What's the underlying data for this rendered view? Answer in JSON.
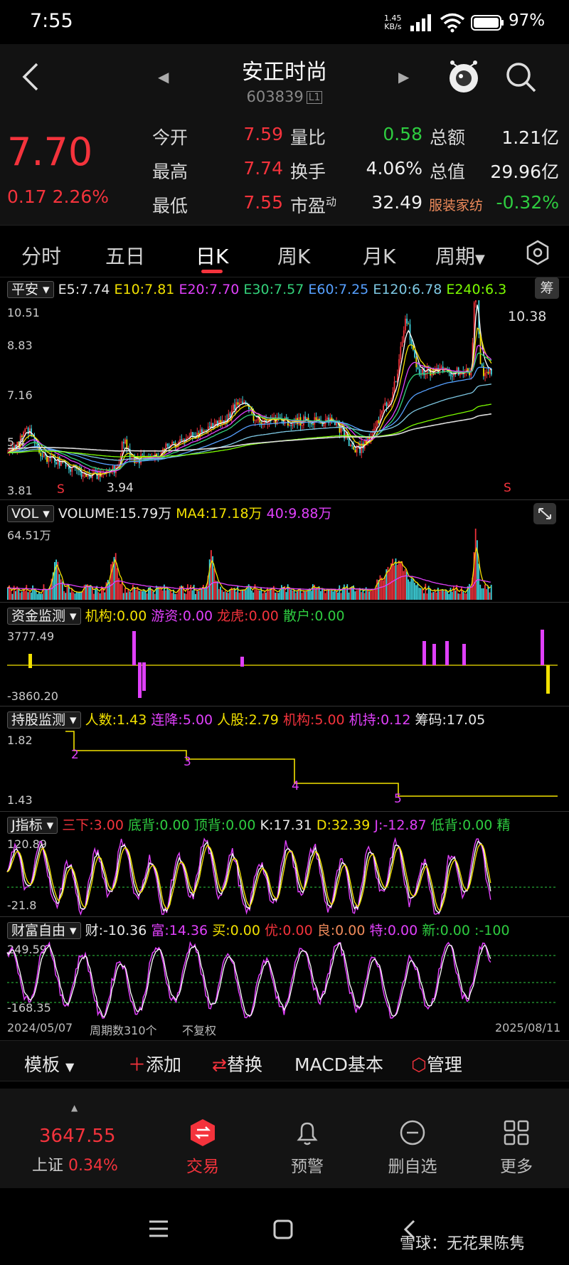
{
  "status_bar": {
    "time": "7:55",
    "net_speed": "1.45",
    "net_unit": "KB/s",
    "battery": "97%"
  },
  "header": {
    "name": "安正时尚",
    "code": "603839",
    "level": "L1"
  },
  "quote": {
    "price": "7.70",
    "change": "0.17 2.26%",
    "rows": [
      {
        "l1": "今开",
        "v1": "7.59",
        "l2": "量比",
        "v2": "0.58",
        "l3": "总额",
        "v3": "1.21亿"
      },
      {
        "l1": "最高",
        "v1": "7.74",
        "l2": "换手",
        "v2": "4.06%",
        "l3": "总值",
        "v3": "29.96亿"
      },
      {
        "l1": "最低",
        "v1": "7.55",
        "l2": "市盈",
        "l2_sup": "动",
        "v2": "32.49",
        "l3": "服装家纺",
        "v3": "-0.32%"
      }
    ]
  },
  "tabs": [
    "分时",
    "五日",
    "日K",
    "周K",
    "月K",
    "周期"
  ],
  "active_tab": "日K",
  "kline": {
    "select": "平安",
    "ma": [
      {
        "label": "E5:",
        "value": "7.74",
        "color": "#ffffff"
      },
      {
        "label": "E10:",
        "value": "7.81",
        "color": "#f2e100"
      },
      {
        "label": "E20:",
        "value": "7.70",
        "color": "#e040fb"
      },
      {
        "label": "E30:",
        "value": "7.57",
        "color": "#33d17a"
      },
      {
        "label": "E60:",
        "value": "7.25",
        "color": "#56a0ff"
      },
      {
        "label": "E120:",
        "value": "6.78",
        "color": "#7ec8e3"
      },
      {
        "label": "E240:",
        "value": "6.3",
        "color": "#7cfc00"
      }
    ],
    "chip_badge": "筹",
    "y_labels": [
      "10.51",
      "8.83",
      "7.16",
      "5.4",
      "3.81"
    ],
    "high_label": "10.38",
    "low_label": "3.94",
    "markers": [
      "S",
      "S"
    ]
  },
  "vol": {
    "select": "VOL",
    "label": "VOLUME:",
    "value": "15.79万",
    "ma4_label": "MA4:",
    "ma4_value": "17.18万",
    "ma40_label": "40:",
    "ma40_value": "9.88万",
    "y_top": "64.51万"
  },
  "fund": {
    "select": "资金监测",
    "items": [
      {
        "label": "机构:",
        "value": "0.00",
        "color": "#f2e100"
      },
      {
        "label": "游资:",
        "value": "0.00",
        "color": "#e040fb"
      },
      {
        "label": "龙虎:",
        "value": "0.00",
        "color": "#f4333c"
      },
      {
        "label": "散户:",
        "value": "0.00",
        "color": "#2ecc40"
      }
    ],
    "y_top": "3777.49",
    "y_bottom": "-3860.20"
  },
  "hold": {
    "select": "持股监测",
    "items": [
      {
        "label": "人数:",
        "value": "1.43",
        "color": "#f2e100"
      },
      {
        "label": "连降:",
        "value": "5.00",
        "color": "#e040fb"
      },
      {
        "label": "人股:",
        "value": "2.79",
        "color": "#f2e100"
      },
      {
        "label": "机构:",
        "value": "5.00",
        "color": "#f4333c"
      },
      {
        "label": "机持:",
        "value": "0.12",
        "color": "#e040fb"
      },
      {
        "label": "筹码:",
        "value": "17.05",
        "color": "#ffffff"
      }
    ],
    "y_top": "1.82",
    "y_bottom": "1.43",
    "steps": [
      "2",
      "3",
      "4",
      "5"
    ]
  },
  "j": {
    "select": "J指标",
    "items": [
      {
        "label": "三下:",
        "value": "3.00",
        "color": "#f4333c"
      },
      {
        "label": "底背:",
        "value": "0.00",
        "color": "#2ecc40"
      },
      {
        "label": "顶背:",
        "value": "0.00",
        "color": "#2ecc40"
      },
      {
        "label": "K:",
        "value": "17.31",
        "color": "#ffffff"
      },
      {
        "label": "D:",
        "value": "32.39",
        "color": "#f2e100"
      },
      {
        "label": "J:",
        "value": "-12.87",
        "color": "#e040fb"
      },
      {
        "label": "低背:",
        "value": "0.00",
        "color": "#2ecc40"
      },
      {
        "label": "精",
        "value": "",
        "color": "#2ecc40"
      }
    ],
    "y_top": "120.89",
    "y_bottom": "-21.8"
  },
  "wealth": {
    "select": "财富自由",
    "items": [
      {
        "label": "财:",
        "value": "-10.36",
        "color": "#ffffff"
      },
      {
        "label": "富:",
        "value": "14.36",
        "color": "#e040fb"
      },
      {
        "label": "买:",
        "value": "0.00",
        "color": "#f2e100"
      },
      {
        "label": "优:",
        "value": "0.00",
        "color": "#f4333c"
      },
      {
        "label": "良:",
        "value": "0.00",
        "color": "#f08b5b"
      },
      {
        "label": "特:",
        "value": "0.00",
        "color": "#e040fb"
      },
      {
        "label": "新:",
        "value": "0.00",
        "color": "#2ecc40"
      },
      {
        "label": ":",
        "value": "-100",
        "color": "#2ecc40"
      }
    ],
    "y_top": "249.59",
    "y_bottom": "-168.35"
  },
  "footer_axis": {
    "start": "2024/05/07",
    "periods": "周期数310个",
    "adjust": "不复权",
    "end": "2025/08/11"
  },
  "toolbar": {
    "template": "模板",
    "add": "添加",
    "replace": "替换",
    "macd": "MACD基本",
    "manage": "管理"
  },
  "index": {
    "value": "3647.55",
    "name": "上证",
    "change": "0.34%"
  },
  "nav": [
    {
      "label": "交易",
      "icon": "trade-icon",
      "active": true
    },
    {
      "label": "预警",
      "icon": "bell-icon",
      "active": false
    },
    {
      "label": "删自选",
      "icon": "minus-circle-icon",
      "active": false
    },
    {
      "label": "更多",
      "icon": "grid-icon",
      "active": false
    }
  ],
  "watermark": "雪球：无花果陈隽",
  "colors": {
    "up": "#f4333c",
    "down": "#2ecc40",
    "accent": "#f4333c"
  }
}
